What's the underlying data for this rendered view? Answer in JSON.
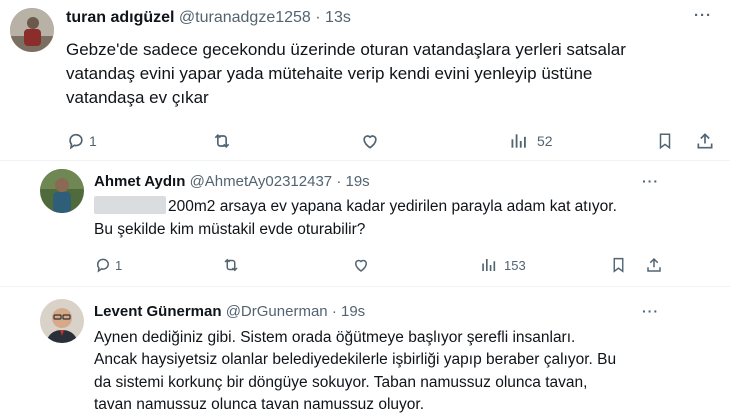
{
  "tweets": [
    {
      "name": "turan adıgüzel",
      "handle": "@turanadgze1258",
      "sep": "·",
      "time": "13s",
      "more": "···",
      "lines": [
        "Gebze'de sadece gecekondu üzerinde oturan vatandaşlara yerleri satsalar",
        "vatandaş evini yapar yada mütehaite verip kendi evini yenleyip üstüne",
        "vatandaşa ev çıkar"
      ],
      "replies": "1",
      "views": "52"
    },
    {
      "name": "Ahmet Aydın",
      "handle": "@AhmetAy02312437",
      "sep": "·",
      "time": "19s",
      "more": "···",
      "lines": [
        "200m2 arsaya ev yapana kadar yedirilen parayla adam kat atıyor.",
        "Bu şekilde kim müstakil evde oturabilir?"
      ],
      "replies": "1",
      "views": "153"
    },
    {
      "name": "Levent Günerman",
      "handle": "@DrGunerman",
      "sep": "·",
      "time": "19s",
      "more": "···",
      "lines": [
        "Aynen dediğiniz gibi. Sistem orada öğütmeye başlıyor şerefli insanları.",
        "Ancak haysiyetsiz olanlar belediyedekilerle işbirliği yapıp beraber çalıyor. Bu",
        "da sistemi korkunç bir döngüye sokuyor. Taban namussuz olunca tavan,",
        "tavan namussuz olunca tavan namussuz oluyor."
      ]
    }
  ],
  "colors": {
    "text": "#0f1419",
    "secondary": "#536471",
    "divider": "#eff3f4"
  }
}
